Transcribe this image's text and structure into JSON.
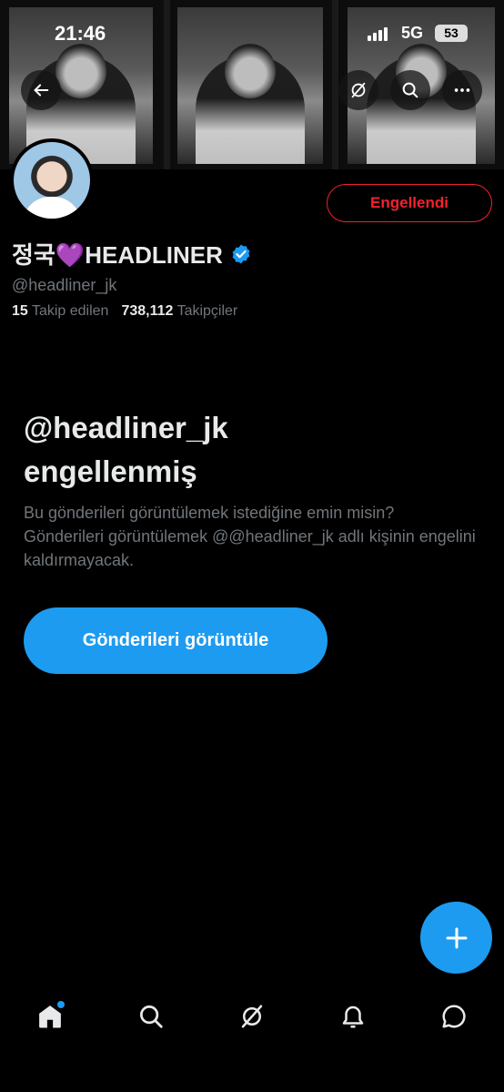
{
  "status_bar": {
    "time": "21:46",
    "network": "5G",
    "battery": "53"
  },
  "header": {
    "back_icon": "arrow-left-icon",
    "grok_icon": "grok-icon",
    "search_icon": "search-icon",
    "more_icon": "more-icon"
  },
  "profile": {
    "display_name": "정국💜HEADLINER",
    "handle": "@headliner_jk",
    "following_count": "15",
    "following_label": "Takip edilen",
    "followers_count": "738,112",
    "followers_label": "Takipçiler",
    "blocked_button_label": "Engellendi"
  },
  "blocked_notice": {
    "title_line1": "@headliner_jk",
    "title_line2": "engellenmiş",
    "description": "Bu gönderileri görüntülemek istediğine emin misin? Gönderileri görüntülemek @@headliner_jk adlı kişinin engelini kaldırmayacak.",
    "view_button_label": "Gönderileri görüntüle"
  },
  "colors": {
    "accent": "#1d9bf0",
    "danger": "#f4212e",
    "muted": "#71767b",
    "text": "#e7e9ea",
    "background": "#000000"
  },
  "bottom_nav": [
    {
      "name": "home",
      "icon": "home-icon"
    },
    {
      "name": "search",
      "icon": "search-icon"
    },
    {
      "name": "grok",
      "icon": "grok-icon"
    },
    {
      "name": "notifications",
      "icon": "bell-icon"
    },
    {
      "name": "messages",
      "icon": "messages-icon"
    }
  ]
}
